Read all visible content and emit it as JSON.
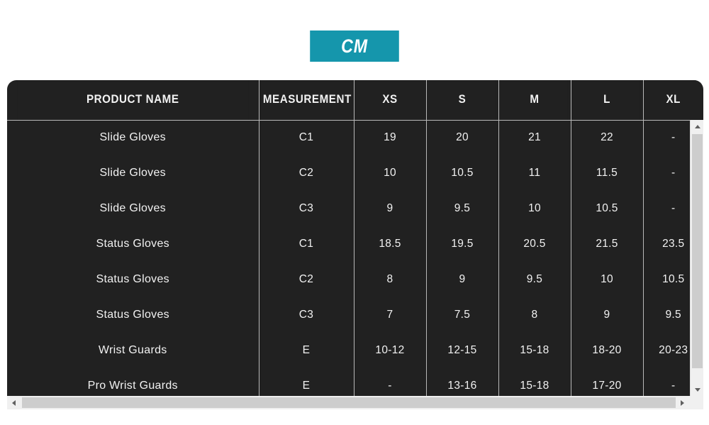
{
  "unit_tab": {
    "label": "CM",
    "accent_color": "#1596ac"
  },
  "table": {
    "headers": [
      "PRODUCT NAME",
      "MEASUREMENT",
      "XS",
      "S",
      "M",
      "L",
      "XL"
    ],
    "rows": [
      {
        "product": "Slide Gloves",
        "measurement": "C1",
        "xs": "19",
        "s": "20",
        "m": "21",
        "l": "22",
        "xl": "-"
      },
      {
        "product": "Slide Gloves",
        "measurement": "C2",
        "xs": "10",
        "s": "10.5",
        "m": "11",
        "l": "11.5",
        "xl": "-"
      },
      {
        "product": "Slide Gloves",
        "measurement": "C3",
        "xs": "9",
        "s": "9.5",
        "m": "10",
        "l": "10.5",
        "xl": "-"
      },
      {
        "product": "Status Gloves",
        "measurement": "C1",
        "xs": "18.5",
        "s": "19.5",
        "m": "20.5",
        "l": "21.5",
        "xl": "23.5"
      },
      {
        "product": "Status Gloves",
        "measurement": "C2",
        "xs": "8",
        "s": "9",
        "m": "9.5",
        "l": "10",
        "xl": "10.5"
      },
      {
        "product": "Status Gloves",
        "measurement": "C3",
        "xs": "7",
        "s": "7.5",
        "m": "8",
        "l": "9",
        "xl": "9.5"
      },
      {
        "product": "Wrist Guards",
        "measurement": "E",
        "xs": "10-12",
        "s": "12-15",
        "m": "15-18",
        "l": "18-20",
        "xl": "20-23"
      },
      {
        "product": "Pro Wrist Guards",
        "measurement": "E",
        "xs": "-",
        "s": "13-16",
        "m": "15-18",
        "l": "17-20",
        "xl": "-"
      }
    ]
  },
  "scrollbars": {
    "vertical": {
      "up_icon": "triangle-up-icon",
      "down_icon": "triangle-down-icon"
    },
    "horizontal": {
      "left_icon": "triangle-left-icon",
      "right_icon": "triangle-right-icon"
    }
  }
}
